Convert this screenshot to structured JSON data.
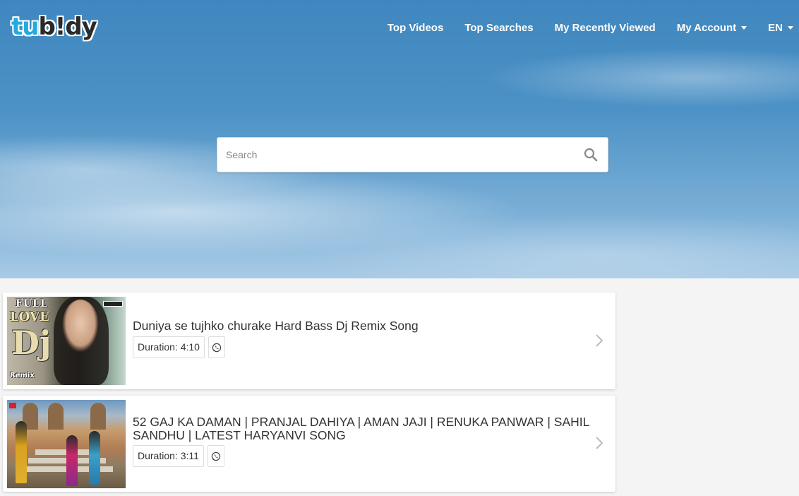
{
  "brand": {
    "logo_part1": "tu",
    "logo_part2": "b!dy"
  },
  "nav": {
    "top_videos": "Top Videos",
    "top_searches": "Top Searches",
    "recently_viewed": "My Recently Viewed",
    "my_account": "My Account",
    "language": "EN"
  },
  "search": {
    "placeholder": "Search",
    "value": ""
  },
  "results": [
    {
      "title": "Duniya se tujhko churake Hard Bass Dj Remix Song",
      "duration": "Duration: 4:10",
      "thumbnail_text": {
        "line1": "FULL",
        "line2": "LOVE",
        "line3": "Dj",
        "line4": "Remix"
      }
    },
    {
      "title": "52 GAJ KA DAMAN | PRANJAL DAHIYA | AMAN JAJI | RENUKA PANWAR | SAHIL SANDHU | LATEST HARYANVI SONG",
      "duration": "Duration: 3:11"
    }
  ],
  "icons": {
    "search": "search-icon",
    "whatsapp": "whatsapp-icon",
    "chevron": "chevron-right-icon",
    "caret": "caret-down-icon"
  },
  "colors": {
    "logo_accent": "#26a9e0",
    "hero_blue": "#4d92c6",
    "nav_text": "#ffffff",
    "page_background": "#f4f4f4"
  }
}
